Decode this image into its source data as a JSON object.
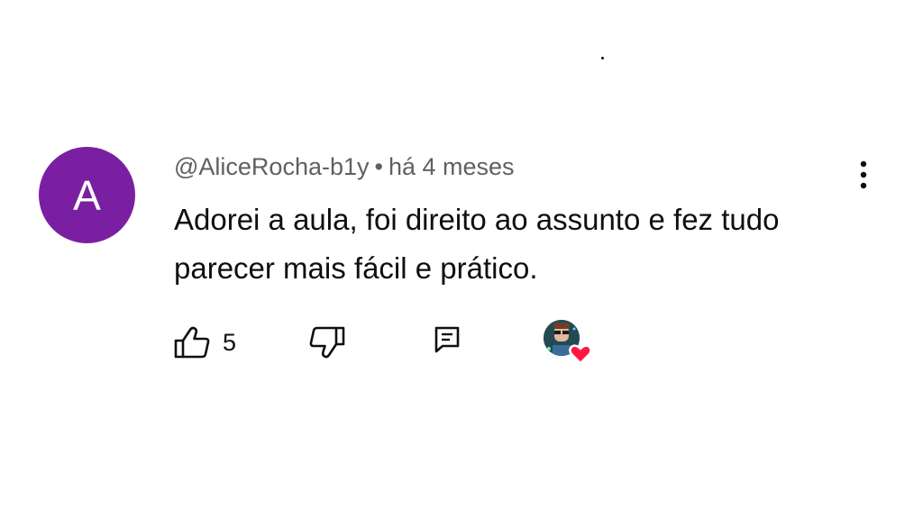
{
  "comment": {
    "avatar_letter": "A",
    "avatar_color": "#7b1fa2",
    "author": "@AliceRocha-b1y",
    "separator": "•",
    "timestamp": "há 4 meses",
    "text": "Adorei a aula, foi direito ao assunto e fez tudo parecer mais fácil e prático.",
    "like_count": "5"
  },
  "icons": {
    "more": "more-vert-icon",
    "like": "thumbs-up-icon",
    "dislike": "thumbs-down-icon",
    "reply": "comment-reply-icon",
    "creator_heart": "creator-heart-icon"
  },
  "colors": {
    "heart": "#ff1744",
    "meta_text": "#606060"
  }
}
